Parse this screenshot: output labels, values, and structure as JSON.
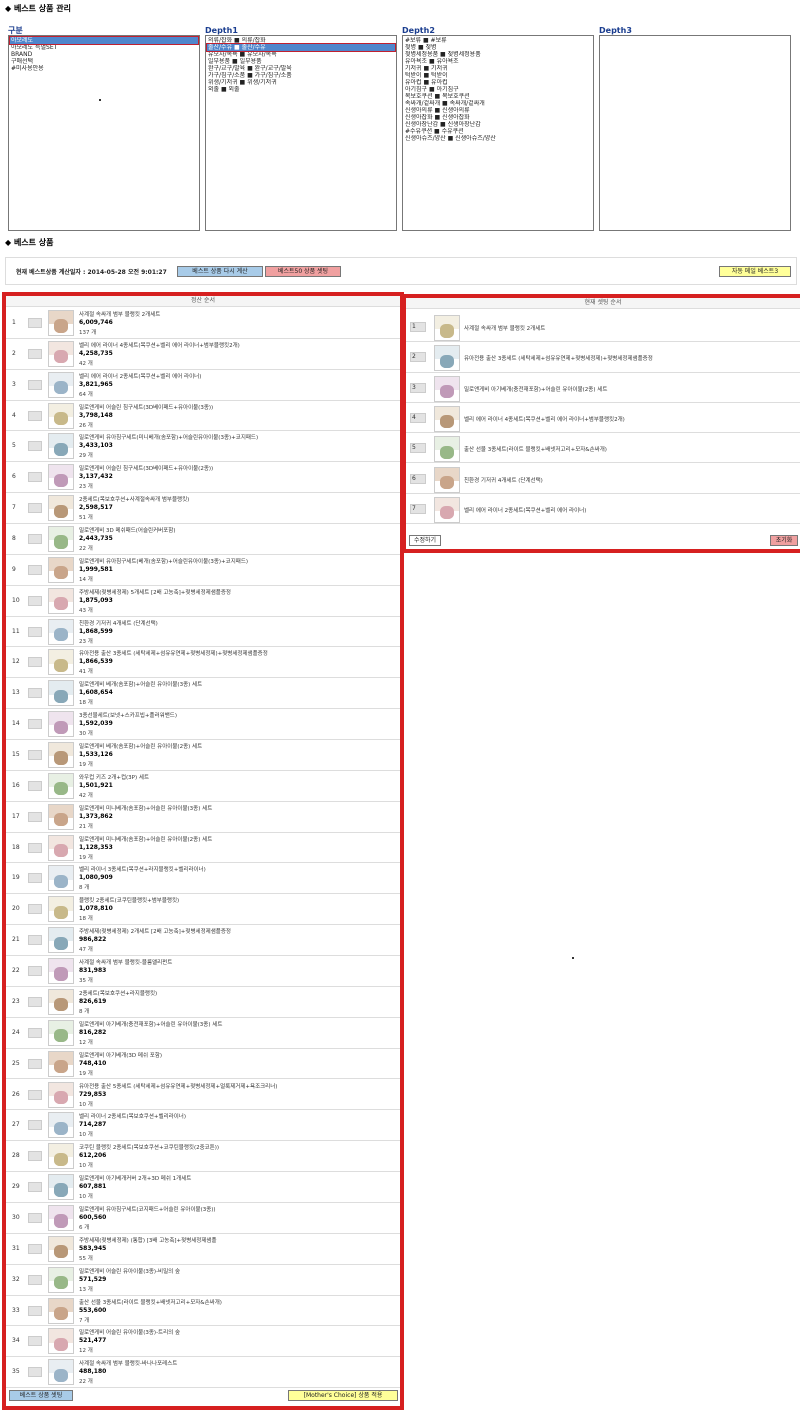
{
  "page_title": "◆ 베스트 상품 관리",
  "best_title": "◆ 베스트 상품",
  "categories": {
    "gubun": {
      "header": "구분",
      "items": [
        {
          "label": "아모레도",
          "selected": true
        },
        {
          "label": "아모레도 특별SET",
          "selected": false
        },
        {
          "label": "BRAND",
          "selected": false
        },
        {
          "label": "구매선택",
          "selected": false
        },
        {
          "label": "#미사용안용",
          "selected": false
        }
      ]
    },
    "depth1": {
      "header": "Depth1",
      "items": [
        {
          "label": "의류/잡화 ■ 의류/잡화",
          "selected": false
        },
        {
          "label": "출산/수유 ■ 출산/수유",
          "selected": true
        },
        {
          "label": "유모차/목욕 ■ 유모차/목욕",
          "selected": false
        },
        {
          "label": "일부용품 ■ 일부용품",
          "selected": false
        },
        {
          "label": "완구/교구/발육 ■ 완구/교구/발육",
          "selected": false
        },
        {
          "label": "가구/침구/소품 ■ 가구/침구/소품",
          "selected": false
        },
        {
          "label": "위생/기저귀 ■ 위생/기저귀",
          "selected": false
        },
        {
          "label": "외출 ■ 외출",
          "selected": false
        }
      ]
    },
    "depth2": {
      "header": "Depth2",
      "items": [
        {
          "label": "#보류 ■ #보류"
        },
        {
          "label": "젖병 ■ 젖병"
        },
        {
          "label": "젖병세정용품 ■ 젖병세정용품"
        },
        {
          "label": "유아욕조 ■ 유아욕조"
        },
        {
          "label": "기저귀 ■ 기저귀"
        },
        {
          "label": "턱받이 ■ 턱받이"
        },
        {
          "label": "유아컵 ■ 유아컵"
        },
        {
          "label": "아기침구 ■ 아기침구"
        },
        {
          "label": "목보호쿠션 ■ 목보호쿠션"
        },
        {
          "label": "속싸개/겉싸개 ■ 속싸개/겉싸개"
        },
        {
          "label": "신생아의류 ■ 신생아의류"
        },
        {
          "label": "신생아잡화 ■ 신생아잡화"
        },
        {
          "label": "신생아장난감 ■ 신생아장난감"
        },
        {
          "label": "#수유쿠션 ■ 수유쿠션"
        },
        {
          "label": "신생아슈즈/양산 ■ 신생아슈즈/양산"
        }
      ]
    },
    "depth3": {
      "header": "Depth3",
      "items": []
    }
  },
  "status_bar": {
    "calc_text": "현재 베스트상품 계산일자 : 2014-05-28 오전 9:01:27",
    "recalc_button": "베스트 상품 다시 계산",
    "top50_button": "베스트50 상품 셋팅",
    "auto_mail_button": "자동 메일 베스트3"
  },
  "left_panel": {
    "title": "정산 순서",
    "rows": [
      {
        "rank": "1",
        "name": "사계절 속싸개 범부 블랭킷 2개세트",
        "amount": "6,009,746",
        "count": "137 개"
      },
      {
        "rank": "2",
        "name": "벨리 에어 라이너 4종세트(목쿠션+벨리 에어 라이너+범부블랭킷2개)",
        "amount": "4,258,735",
        "count": "42 개"
      },
      {
        "rank": "3",
        "name": "벨리 에어 라이너 2종세트(목쿠션+벨리 에어 라이너)",
        "amount": "3,821,965",
        "count": "64 개"
      },
      {
        "rank": "4",
        "name": "밀로앤게비 어슬린 침구세트(3D베이패드+유아이불(3종))",
        "amount": "3,798,148",
        "count": "26 개"
      },
      {
        "rank": "5",
        "name": "밀로앤게비 유아침구세트(미니베개(솜포함)+어슬린유아이불(3종)+코지패드)",
        "amount": "3,433,103",
        "count": "29 개"
      },
      {
        "rank": "6",
        "name": "밀로앤게비 어슬린 침구세트(3D베이패드+유아이불(2종))",
        "amount": "3,137,432",
        "count": "23 개"
      },
      {
        "rank": "7",
        "name": "2종세트(목보호쿠션+사계절속싸개 범부블랭킷)",
        "amount": "2,598,517",
        "count": "51 개"
      },
      {
        "rank": "8",
        "name": "밀로앤게비 3D 메쉬패드(어슬린커버포함)",
        "amount": "2,443,735",
        "count": "22 개"
      },
      {
        "rank": "9",
        "name": "밀로앤게비 유아침구세트(베개(솜포함)+어슬린유아이불(3종)+코지패드)",
        "amount": "1,999,581",
        "count": "14 개"
      },
      {
        "rank": "10",
        "name": "주방세제(젖병세정제) 5개세트 [2배 고농축]+젖병세정제샘플증정",
        "amount": "1,875,093",
        "count": "43 개"
      },
      {
        "rank": "11",
        "name": "친환경 기저귀 4개세트 (단계선택)",
        "amount": "1,868,599",
        "count": "23 개"
      },
      {
        "rank": "12",
        "name": "유아전용 출산 3종세트 (세탁세제+섬유유연제+젖병세정제)+젖병세정제샘플증정",
        "amount": "1,866,539",
        "count": "41 개"
      },
      {
        "rank": "13",
        "name": "밀로앤게비 베개(솜포함)+어슬린 유아이불(3종) 세트",
        "amount": "1,608,654",
        "count": "18 개"
      },
      {
        "rank": "14",
        "name": "3종선물세트(보넷+스카프빕+플러워밴드)",
        "amount": "1,592,039",
        "count": "30 개"
      },
      {
        "rank": "15",
        "name": "밀로앤게비 베개(솜포함)+어슬린 유아이불(2종) 세트",
        "amount": "1,533,126",
        "count": "19 개"
      },
      {
        "rank": "16",
        "name": "와우컵 키즈 2개+컵(3P) 세트",
        "amount": "1,501,921",
        "count": "42 개"
      },
      {
        "rank": "17",
        "name": "밀로앤게비 미니베개(솜포함)+어슬린 유아이불(3종) 세트",
        "amount": "1,373,862",
        "count": "21 개"
      },
      {
        "rank": "18",
        "name": "밀로앤게비 미니베개(솜포함)+어슬린 유아이불(2종) 세트",
        "amount": "1,128,353",
        "count": "19 개"
      },
      {
        "rank": "19",
        "name": "벨리 라이너 3종세트(목쿠션+라지블랭킷+벨리라이너)",
        "amount": "1,080,909",
        "count": "8 개"
      },
      {
        "rank": "20",
        "name": "블랭킷 2종세트(코쿠틴블랭킷+범부블랭킷)",
        "amount": "1,078,810",
        "count": "18 개"
      },
      {
        "rank": "21",
        "name": "주방세제(젖병세정제) 2개세트 [2배 고농축]+젖병세정제샘플증정",
        "amount": "986,822",
        "count": "47 개"
      },
      {
        "rank": "22",
        "name": "사계절 속싸개 범부 블랭킷-블룸앨리펀트",
        "amount": "831,983",
        "count": "35 개"
      },
      {
        "rank": "23",
        "name": "2종세트(목보호쿠션+라지블랭킷)",
        "amount": "826,619",
        "count": "8 개"
      },
      {
        "rank": "24",
        "name": "밀로앤게비 아기베개(충전재포함)+어슬린 유아이불(3종) 세트",
        "amount": "816,282",
        "count": "12 개"
      },
      {
        "rank": "25",
        "name": "밀로앤게비 아기베개(3D 메쉬 포함)",
        "amount": "748,410",
        "count": "19 개"
      },
      {
        "rank": "26",
        "name": "유아전용 출산 5종세트 (세탁세제+섬유유연제+젖병세정제+얼룩제거제+욕조크리너)",
        "amount": "729,853",
        "count": "10 개"
      },
      {
        "rank": "27",
        "name": "벨리 라이너 2종세트(목보호쿠션+벨리라이너)",
        "amount": "714,287",
        "count": "10 개"
      },
      {
        "rank": "28",
        "name": "코쿠틴 블랭킷 2종세트(목보호쿠션+코쿠틴블랭킷(2중코튼))",
        "amount": "612,206",
        "count": "10 개"
      },
      {
        "rank": "29",
        "name": "밀로앤게비 아기베개커버 2개+3D 메쉬 1개세트",
        "amount": "607,881",
        "count": "10 개"
      },
      {
        "rank": "30",
        "name": "밀로앤게비 유아침구세트(코지패드+어슬린 유아이불(3종))",
        "amount": "600,560",
        "count": "6 개"
      },
      {
        "rank": "31",
        "name": "주방세제(젖병세정제) (통합) [3배 고농축]+젖병세정제샘플",
        "amount": "583,945",
        "count": "55 개"
      },
      {
        "rank": "32",
        "name": "밀로앤게비 어슬린 유아이불(3종)-비밀의 숲",
        "amount": "571,529",
        "count": "13 개"
      },
      {
        "rank": "33",
        "name": "출산 선물 3종세트(라이트 블랭킷+배넷저고리+모자&손싸개)",
        "amount": "553,600",
        "count": "7 개"
      },
      {
        "rank": "34",
        "name": "밀로앤게비 어슬린 유아이불(3종)-트리의 숲",
        "amount": "521,477",
        "count": "12 개"
      },
      {
        "rank": "35",
        "name": "사계절 속싸개 범부 블랭킷-바나나포레스트",
        "amount": "488,180",
        "count": "22 개"
      }
    ],
    "bottom_left_button": "베스트 상품 셋팅",
    "bottom_right_button": "[Mother's Choice] 상품 적용"
  },
  "right_panel": {
    "title": "현재 셋팅 순서",
    "rows": [
      {
        "rank": "1",
        "name": "사계절 속싸개 범부 블랭킷 2개세트"
      },
      {
        "rank": "2",
        "name": "유아전용 출산 3종세트 (세탁세제+섬유유연제+젖병세정제)+젖병세정제샘플증정"
      },
      {
        "rank": "3",
        "name": "밀로앤게비 아기베개(충전재포함)+어슬린 유아이불(2종) 세트"
      },
      {
        "rank": "4",
        "name": "벨리 에어 라이너 4종세트(목쿠션+벨리 에어 라이너+범부블랭킷2개)"
      },
      {
        "rank": "5",
        "name": "출산 선물 3종세트(라이트 블랭킷+배넷저고리+모자&손싸개)"
      },
      {
        "rank": "6",
        "name": "친환경 기저귀 4개세트 (단계선택)"
      },
      {
        "rank": "7",
        "name": "벨리 에어 라이너 2종세트(목쿠션+벨리 에어 라이너)"
      }
    ],
    "edit_button": "수정하기",
    "reset_button": "초기화"
  },
  "colors": {
    "panel_border": "#d62020",
    "list_selected": "#4f86cc",
    "button_blue": "#a8cbe8",
    "button_red": "#f0a0a0",
    "button_yellow": "#ffff99"
  }
}
